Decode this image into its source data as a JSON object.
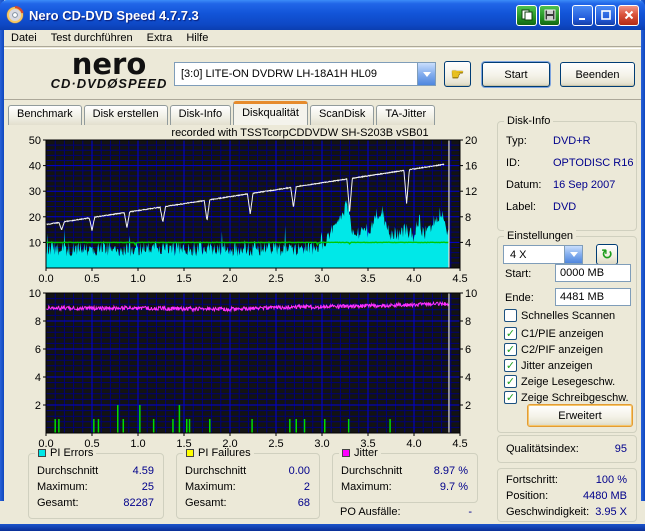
{
  "window": {
    "title": "Nero CD-DVD Speed 4.7.7.3"
  },
  "titlebar_buttons": {
    "copy": "copy-to-clipboard",
    "save": "save-screenshot",
    "minimize": "minimize",
    "maximize": "maximize",
    "close": "close"
  },
  "menu": {
    "items": [
      "Datei",
      "Test durchführen",
      "Extra",
      "Hilfe"
    ]
  },
  "header": {
    "logo_line1": "nero",
    "logo_line2": "CD·DVDØSPEED",
    "drive": "[3:0]   LITE-ON DVDRW LH-18A1H HL09",
    "start_button": "Start",
    "quit_button": "Beenden"
  },
  "tabs": {
    "items": [
      {
        "label": "Benchmark",
        "active": false
      },
      {
        "label": "Disk erstellen",
        "active": false
      },
      {
        "label": "Disk-Info",
        "active": false
      },
      {
        "label": "Diskqualität",
        "active": true
      },
      {
        "label": "ScanDisk",
        "active": false
      },
      {
        "label": "TA-Jitter",
        "active": false
      }
    ]
  },
  "disk_info": {
    "title": "Disk-Info",
    "rows": [
      {
        "label": "Typ:",
        "value": "DVD+R"
      },
      {
        "label": "ID:",
        "value": "OPTODISC R16"
      },
      {
        "label": "Datum:",
        "value": "16 Sep 2007"
      },
      {
        "label": "Label:",
        "value": "DVD"
      }
    ]
  },
  "settings": {
    "title": "Einstellungen",
    "speed_value": "4 X",
    "start_label": "Start:",
    "start_value": "0000 MB",
    "end_label": "Ende:",
    "end_value": "4481 MB",
    "checkboxes": [
      {
        "label": "Schnelles Scannen",
        "checked": false
      },
      {
        "label": "C1/PIE anzeigen",
        "checked": true
      },
      {
        "label": "C2/PIF anzeigen",
        "checked": true
      },
      {
        "label": "Jitter anzeigen",
        "checked": true
      },
      {
        "label": "Zeige Lesegeschw.",
        "checked": true
      },
      {
        "label": "Zeige Schreibgeschw.",
        "checked": true
      }
    ],
    "advanced_button": "Erweitert"
  },
  "quality": {
    "label": "Qualitätsindex:",
    "value": "95"
  },
  "progress": {
    "rows": [
      {
        "label": "Fortschritt:",
        "value": "100 %"
      },
      {
        "label": "Position:",
        "value": "4480 MB"
      },
      {
        "label": "Geschwindigkeit:",
        "value": "3.95 X"
      }
    ]
  },
  "stats": {
    "pi_errors": {
      "title": "PI Errors",
      "color": "#00E8E8",
      "rows": [
        {
          "label": "Durchschnitt",
          "value": "4.59"
        },
        {
          "label": "Maximum:",
          "value": "25"
        },
        {
          "label": "Gesamt:",
          "value": "82287"
        }
      ]
    },
    "pi_failures": {
      "title": "PI Failures",
      "color": "#FFFF00",
      "rows": [
        {
          "label": "Durchschnitt",
          "value": "0.00"
        },
        {
          "label": "Maximum:",
          "value": "2"
        },
        {
          "label": "Gesamt:",
          "value": "68"
        }
      ]
    },
    "jitter": {
      "title": "Jitter",
      "color": "#FF00FF",
      "rows": [
        {
          "label": "Durchschnitt",
          "value": "8.97 %"
        },
        {
          "label": "Maximum:",
          "value": "9.7 %"
        }
      ]
    },
    "po": {
      "label": "PO Ausfälle:",
      "value": "-"
    }
  },
  "chart_data": [
    {
      "type": "area",
      "title": "recorded with TSSTcorpCDDVDW SH-S203B  vSB01",
      "x": {
        "min": 0,
        "max": 4.5,
        "major": 0.5,
        "minor": 0.1,
        "ticks": [
          "0.0",
          "0.5",
          "1.0",
          "1.5",
          "2.0",
          "2.5",
          "3.0",
          "3.5",
          "4.0",
          "4.5"
        ]
      },
      "left": {
        "min": 0,
        "max": 50,
        "major": 10,
        "minor": 2,
        "ticks": [
          50,
          40,
          30,
          20,
          10
        ]
      },
      "right": {
        "min": 0,
        "max": 20,
        "ticks": [
          20,
          16,
          12,
          8,
          4
        ]
      },
      "cursor_x": 4.38,
      "series": [
        {
          "name": "C1/PIE errors",
          "type": "area",
          "axis": "left",
          "color": "#00E8E8",
          "x_end": 4.38,
          "envelope": [
            [
              0,
              9.5
            ],
            [
              0.3,
              9
            ],
            [
              0.6,
              9.5
            ],
            [
              0.9,
              9
            ],
            [
              1.2,
              9.5
            ],
            [
              1.5,
              9
            ],
            [
              1.8,
              9.5
            ],
            [
              2.1,
              9
            ],
            [
              2.4,
              9.5
            ],
            [
              2.7,
              9
            ],
            [
              2.85,
              9.5
            ],
            [
              2.95,
              10
            ],
            [
              3.05,
              13
            ],
            [
              3.15,
              18
            ],
            [
              3.22,
              24
            ],
            [
              3.28,
              26
            ],
            [
              3.33,
              16
            ],
            [
              3.4,
              15
            ],
            [
              3.45,
              19
            ],
            [
              3.5,
              16
            ],
            [
              3.55,
              18
            ],
            [
              3.6,
              23
            ],
            [
              3.65,
              25
            ],
            [
              3.7,
              18
            ],
            [
              3.75,
              15
            ],
            [
              3.8,
              16
            ],
            [
              3.85,
              14
            ],
            [
              3.9,
              17
            ],
            [
              3.95,
              15
            ],
            [
              4.0,
              14
            ],
            [
              4.05,
              21
            ],
            [
              4.1,
              15
            ],
            [
              4.15,
              17
            ],
            [
              4.2,
              19
            ],
            [
              4.25,
              21
            ],
            [
              4.3,
              24
            ],
            [
              4.33,
              20
            ],
            [
              4.38,
              14
            ]
          ]
        },
        {
          "name": "write speed",
          "type": "const",
          "axis": "right",
          "color": "#00C800",
          "value": 4.0,
          "x_end": 4.38,
          "dips": [
            [
              0.97,
              0.35
            ],
            [
              2.95,
              0.3
            ],
            [
              3.3,
              0.25
            ]
          ]
        },
        {
          "name": "read speed",
          "type": "ramp",
          "axis": "right",
          "color": "#F2F2F2",
          "x_end": 4.33,
          "v0": 6.8,
          "v1": 16.2,
          "dips": [
            [
              0.17,
              1.2
            ],
            [
              0.5,
              2.0
            ],
            [
              0.88,
              2.4
            ],
            [
              1.27,
              2.4
            ],
            [
              1.75,
              3.2
            ],
            [
              2.22,
              3.2
            ],
            [
              2.69,
              3.2
            ],
            [
              3.3,
              5.2
            ],
            [
              3.92,
              5.2
            ]
          ]
        }
      ]
    },
    {
      "type": "line",
      "title": "",
      "x": {
        "min": 0,
        "max": 4.5,
        "major": 0.5,
        "minor": 0.1,
        "ticks": [
          "0.0",
          "0.5",
          "1.0",
          "1.5",
          "2.0",
          "2.5",
          "3.0",
          "3.5",
          "4.0",
          "4.5"
        ]
      },
      "left": {
        "min": 0,
        "max": 10,
        "major": 2,
        "minor": 0.4,
        "ticks": [
          10,
          8,
          6,
          4,
          2
        ]
      },
      "right": {
        "min": 0,
        "max": 10,
        "ticks": [
          10,
          8,
          6,
          4,
          2
        ]
      },
      "cursor_x": 4.38,
      "series": [
        {
          "name": "PI failures",
          "type": "spikes",
          "axis": "left",
          "color": "#00DD00",
          "points": [
            [
              0.1,
              1
            ],
            [
              0.14,
              1
            ],
            [
              0.52,
              1
            ],
            [
              0.57,
              1
            ],
            [
              0.78,
              2
            ],
            [
              0.84,
              1
            ],
            [
              1.02,
              2
            ],
            [
              1.17,
              1
            ],
            [
              1.38,
              1
            ],
            [
              1.45,
              2
            ],
            [
              1.53,
              1
            ],
            [
              1.56,
              1
            ],
            [
              1.78,
              1
            ],
            [
              2.24,
              1
            ],
            [
              2.65,
              1
            ],
            [
              2.72,
              1
            ],
            [
              2.81,
              1
            ],
            [
              3.03,
              1
            ],
            [
              3.29,
              1
            ],
            [
              3.74,
              1
            ]
          ]
        },
        {
          "name": "jitter",
          "type": "noisy",
          "axis": "left",
          "color": "#FF30FF",
          "x_end": 4.38,
          "envelope": [
            [
              0,
              8.95
            ],
            [
              0.3,
              8.9
            ],
            [
              0.6,
              8.9
            ],
            [
              0.9,
              8.95
            ],
            [
              1.2,
              8.9
            ],
            [
              1.5,
              8.88
            ],
            [
              1.8,
              8.85
            ],
            [
              2.1,
              8.85
            ],
            [
              2.4,
              8.95
            ],
            [
              2.7,
              9.0
            ],
            [
              3.0,
              9.02
            ],
            [
              3.3,
              9.05
            ],
            [
              3.6,
              9.1
            ],
            [
              3.9,
              9.15
            ],
            [
              4.1,
              9.2
            ],
            [
              4.38,
              9.22
            ]
          ]
        }
      ]
    }
  ]
}
